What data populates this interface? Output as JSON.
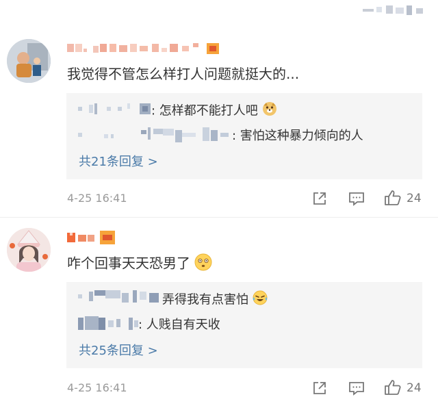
{
  "comments": [
    {
      "text": "我觉得不管怎么样打人问题就挺大的...",
      "replies": [
        {
          "text": ": 怎样都不能打人吧"
        },
        {
          "text": ": 害怕这种暴力倾向的人"
        }
      ],
      "more_replies": "共21条回复 >",
      "time": "4-25 16:41",
      "likes": "24"
    },
    {
      "text": "咋个回事天天恐男了",
      "replies": [
        {
          "text": "弄得我有点害怕"
        },
        {
          "text": ": 人贱自有天收"
        }
      ],
      "more_replies": "共25条回复 >",
      "time": "4-25 16:41",
      "likes": "24"
    }
  ],
  "colors": {
    "link": "#4a7aa8",
    "meta": "#9a9a9a",
    "reply_bg": "#f5f5f5"
  },
  "icons": [
    "share-icon",
    "comment-icon",
    "like-icon",
    "emoji-icon"
  ]
}
